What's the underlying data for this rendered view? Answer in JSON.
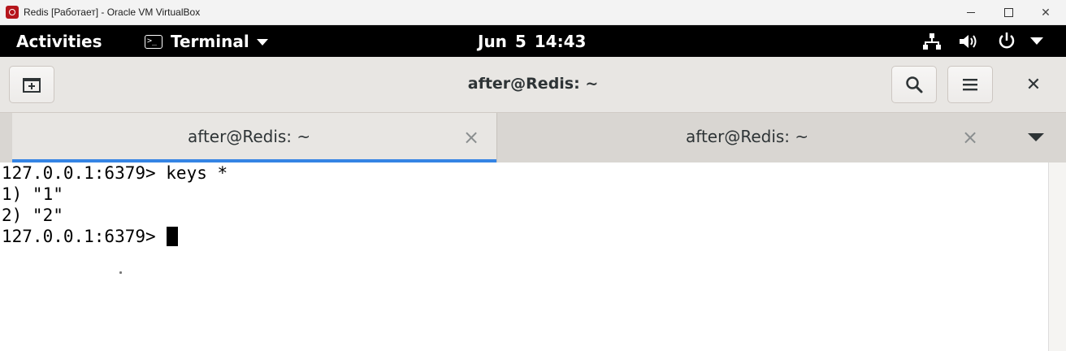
{
  "host_window": {
    "title": "Redis [Работает] - Oracle VM VirtualBox",
    "app_icon": "virtualbox-icon",
    "controls": [
      "minimize-icon",
      "maximize-icon",
      "close-icon"
    ],
    "close_glyph": "✕"
  },
  "topbar": {
    "activities_label": "Activities",
    "app_menu_label": "Terminal",
    "app_menu_glyph": ">_",
    "clock": "Jun 5  14:43",
    "status_icons": [
      "network-icon",
      "volume-icon",
      "power-icon",
      "chevron-down-icon"
    ]
  },
  "headerbar": {
    "title": "after@Redis: ~",
    "close_glyph": "✕"
  },
  "tabs": [
    {
      "label": "after@Redis: ~",
      "active": true,
      "close_glyph": "×"
    },
    {
      "label": "after@Redis: ~",
      "active": false,
      "close_glyph": "×"
    }
  ],
  "terminal": {
    "lines": [
      "127.0.0.1:6379> keys *",
      "1) \"1\"",
      "2) \"2\"",
      "127.0.0.1:6379> "
    ]
  },
  "colors": {
    "topbar_bg": "#000000",
    "headerbar_bg": "#e8e6e3",
    "active_tab_indicator": "#3584e4",
    "virtualbox_icon": "#b5161c"
  }
}
